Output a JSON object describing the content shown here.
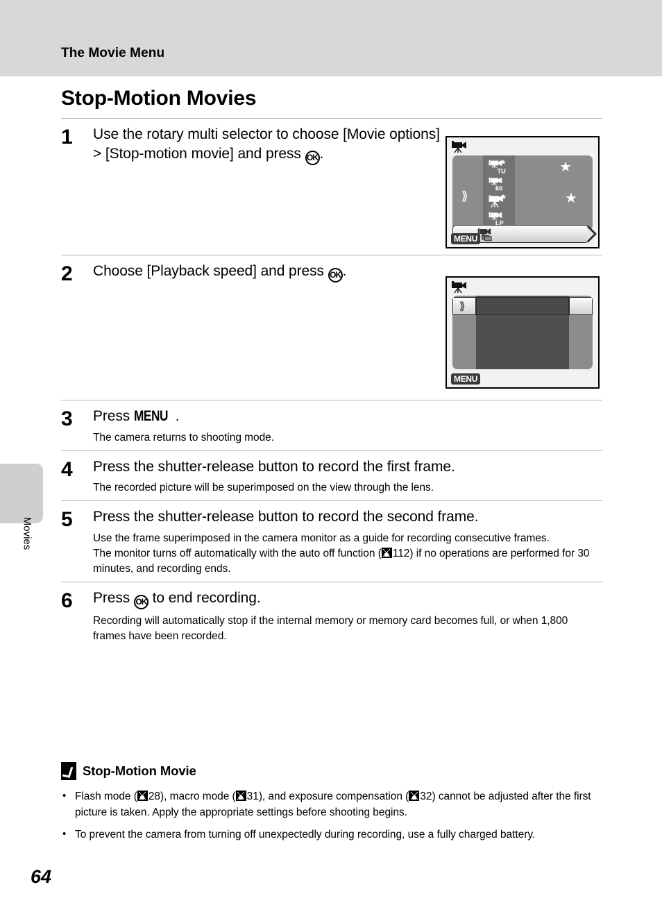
{
  "header": {
    "running_title": "The Movie Menu"
  },
  "page": {
    "chapter_title": "Stop-Motion Movies",
    "page_number": "64",
    "side_tab_label": "Movies"
  },
  "steps": [
    {
      "number": "1",
      "head_before_ok": "Use the rotary multi selector to choose [Movie options] > [Stop-motion movie] and press ",
      "head_after_ok": ".",
      "sub": []
    },
    {
      "number": "2",
      "head_before_ok": "Choose [Playback speed] and press ",
      "head_after_ok": ".",
      "sub": []
    },
    {
      "number": "3",
      "head_prefix": "Press ",
      "head_menu_word": "MENU",
      "head_suffix": ".",
      "sub": [
        "The camera returns to shooting mode."
      ]
    },
    {
      "number": "4",
      "head": "Press the shutter-release button to record the first frame.",
      "sub": [
        "The recorded picture will be superimposed on the view through the lens."
      ]
    },
    {
      "number": "5",
      "head": "Press the shutter-release button to record the second frame.",
      "sub_line1": "Use the frame superimposed in the camera monitor as a guide for recording consecutive frames.",
      "sub_line2_a": "The monitor turns off automatically with the auto off function (",
      "sub_line2_ref": "112",
      "sub_line2_b": ") if no operations are performed for 30 minutes, and recording ends."
    },
    {
      "number": "6",
      "head_prefix": "Press ",
      "head_suffix": " to end recording.",
      "sub": [
        "Recording will automatically stop if the internal memory or memory card becomes full, or when 1,800 frames have been recorded."
      ]
    }
  ],
  "screens": {
    "screen1": {
      "top_icon_name": "movie-camera-tripod-icon",
      "menu_badge": "MENU",
      "items": [
        {
          "label": "TU",
          "icon": "movie-camera-star-icon"
        },
        {
          "label": "60",
          "icon": "movie-camera-icon"
        },
        {
          "label": "",
          "icon": "movie-camera-tripod-star-icon"
        },
        {
          "label": "LP",
          "icon": "movie-camera-icon"
        }
      ],
      "stars": 2,
      "selected_icon": "stop-motion-movie-icon"
    },
    "screen2": {
      "top_icon_name": "movie-camera-tripod-icon",
      "menu_badge": "MENU"
    }
  },
  "note": {
    "title": "Stop-Motion Movie",
    "bullets": [
      {
        "seg_a": "Flash mode (",
        "ref_1": "28",
        "seg_b": "), macro mode (",
        "ref_2": "31",
        "seg_c": "), and exposure compensation (",
        "ref_3": "32",
        "seg_d": ") cannot be adjusted after the first picture is taken. Apply the appropriate settings before shooting begins."
      },
      {
        "text": "To prevent the camera from turning off unexpectedly during recording, use a fully charged battery."
      }
    ]
  }
}
